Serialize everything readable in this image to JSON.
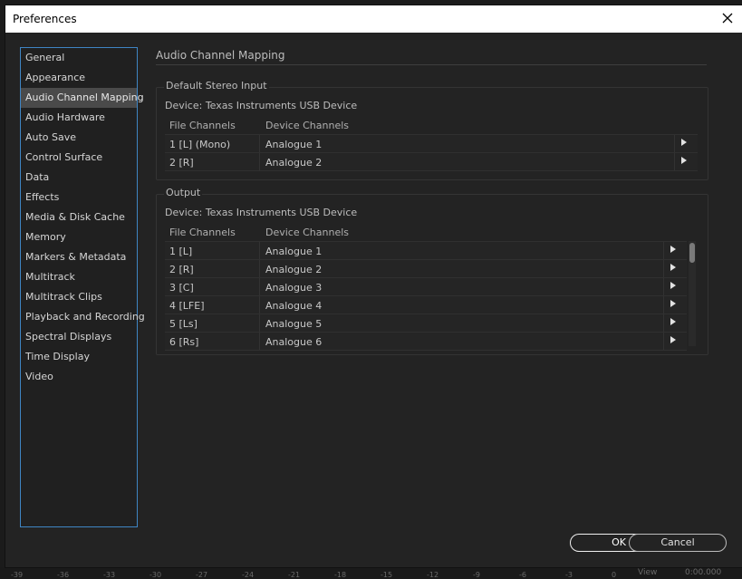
{
  "window": {
    "title": "Preferences"
  },
  "nav": {
    "items": [
      "General",
      "Appearance",
      "Audio Channel Mapping",
      "Audio Hardware",
      "Auto Save",
      "Control Surface",
      "Data",
      "Effects",
      "Media & Disk Cache",
      "Memory",
      "Markers & Metadata",
      "Multitrack",
      "Multitrack Clips",
      "Playback and Recording",
      "Spectral Displays",
      "Time Display",
      "Video"
    ],
    "selected": "Audio Channel Mapping"
  },
  "panel": {
    "title": "Audio Channel Mapping",
    "input": {
      "legend": "Default Stereo Input",
      "device": "Device: Texas Instruments USB Device",
      "col_file": "File Channels",
      "col_device": "Device Channels",
      "rows": [
        {
          "file": "1 [L] (Mono)",
          "device": "Analogue 1"
        },
        {
          "file": "2 [R]",
          "device": "Analogue 2"
        }
      ]
    },
    "output": {
      "legend": "Output",
      "device": "Device: Texas Instruments USB Device",
      "col_file": "File Channels",
      "col_device": "Device Channels",
      "rows": [
        {
          "file": "1 [L]",
          "device": "Analogue 1"
        },
        {
          "file": "2 [R]",
          "device": "Analogue 2"
        },
        {
          "file": "3 [C]",
          "device": "Analogue 3"
        },
        {
          "file": "4 [LFE]",
          "device": "Analogue 4"
        },
        {
          "file": "5 [Ls]",
          "device": "Analogue 5"
        },
        {
          "file": "6 [Rs]",
          "device": "Analogue 6"
        }
      ]
    }
  },
  "buttons": {
    "ok": "OK",
    "cancel": "Cancel"
  },
  "background": {
    "ruler_ticks": [
      "-39",
      "-36",
      "-33",
      "-30",
      "-27",
      "-24",
      "-21",
      "-18",
      "-15",
      "-12",
      "-9",
      "-6",
      "-3",
      "0"
    ],
    "view_label": "View",
    "timecode": "0:00.000"
  },
  "colors": {
    "accent": "#3f85c4",
    "selected_bg": "#4a4a4a",
    "dialog_bg": "#232323"
  }
}
